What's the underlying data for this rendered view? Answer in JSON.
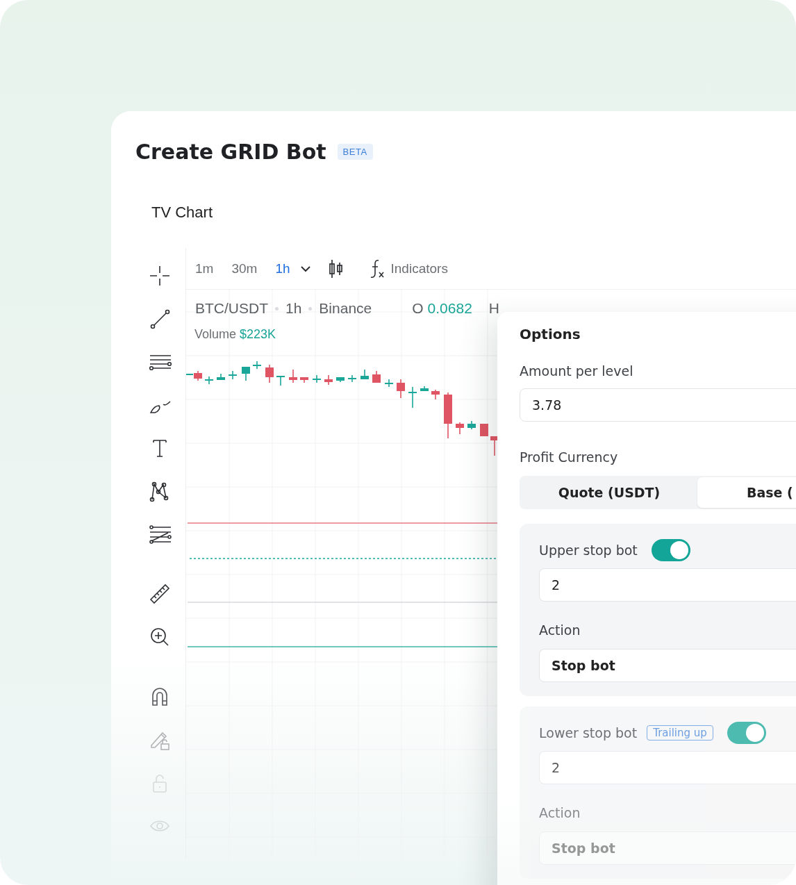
{
  "title": "Create GRID Bot",
  "badge": "BETA",
  "section": "TV Chart",
  "chart": {
    "timeframes": [
      {
        "label": "1m",
        "selected": false
      },
      {
        "label": "30m",
        "selected": false
      },
      {
        "label": "1h",
        "selected": true
      }
    ],
    "indicators": "Indicators",
    "symbol": "BTC/USDT",
    "interval": "1h",
    "exchange": "Binance",
    "open_label": "O",
    "open_value": "0.0682",
    "high_label": "H",
    "volume_label": "Volume",
    "volume_value": "$223K"
  },
  "options": {
    "title": "Options",
    "amount": {
      "label": "Amount per level",
      "value": "3.78"
    },
    "profit_currency": {
      "label": "Profit Currency",
      "options": [
        {
          "label": "Quote (USDT)",
          "selected": false
        },
        {
          "label": "Base (",
          "selected": true
        }
      ]
    },
    "stops": [
      {
        "label": "Upper stop bot",
        "on": true,
        "value": "2",
        "action_label": "Action",
        "action": "Stop bot"
      },
      {
        "label": "Lower stop bot",
        "badge": "Trailing up",
        "on": true,
        "value": "2",
        "action_label": "Action",
        "action": "Stop bot"
      }
    ]
  }
}
